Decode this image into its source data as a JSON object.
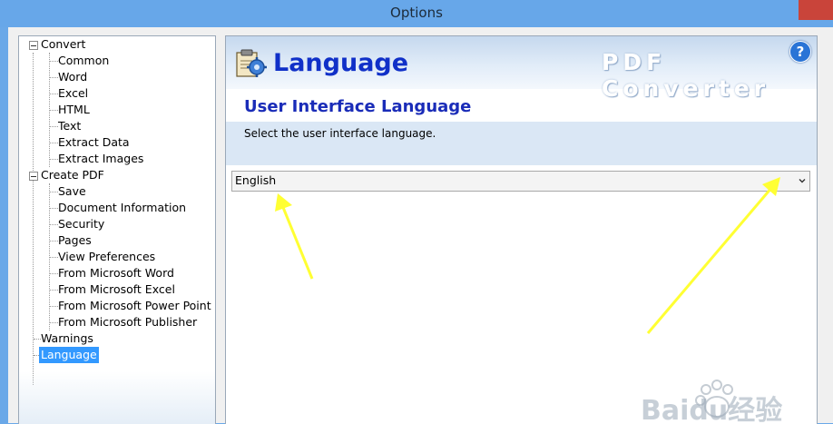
{
  "window": {
    "title": "Options"
  },
  "tree": {
    "groups": [
      {
        "label": "Convert",
        "items": [
          "Common",
          "Word",
          "Excel",
          "HTML",
          "Text",
          "Extract Data",
          "Extract Images"
        ]
      },
      {
        "label": "Create PDF",
        "items": [
          "Save",
          "Document Information",
          "Security",
          "Pages",
          "View Preferences",
          "From Microsoft Word",
          "From Microsoft Excel",
          "From Microsoft Power Point",
          "From Microsoft Publisher"
        ]
      }
    ],
    "tail": [
      "Warnings",
      "Language"
    ],
    "selected": "Language"
  },
  "panel": {
    "header_title": "Language",
    "brand": "PDF Converter",
    "help_glyph": "?",
    "section_title": "User Interface Language",
    "description": "Select the user interface language.",
    "language_select": {
      "value": "English"
    }
  },
  "annotations": {
    "arrow_color": "#ffff33"
  },
  "watermark": {
    "text": "Baidu经验"
  },
  "colors": {
    "titlebar": "#67a7e9",
    "selection": "#3399ff",
    "header_blue": "#1030c8"
  }
}
